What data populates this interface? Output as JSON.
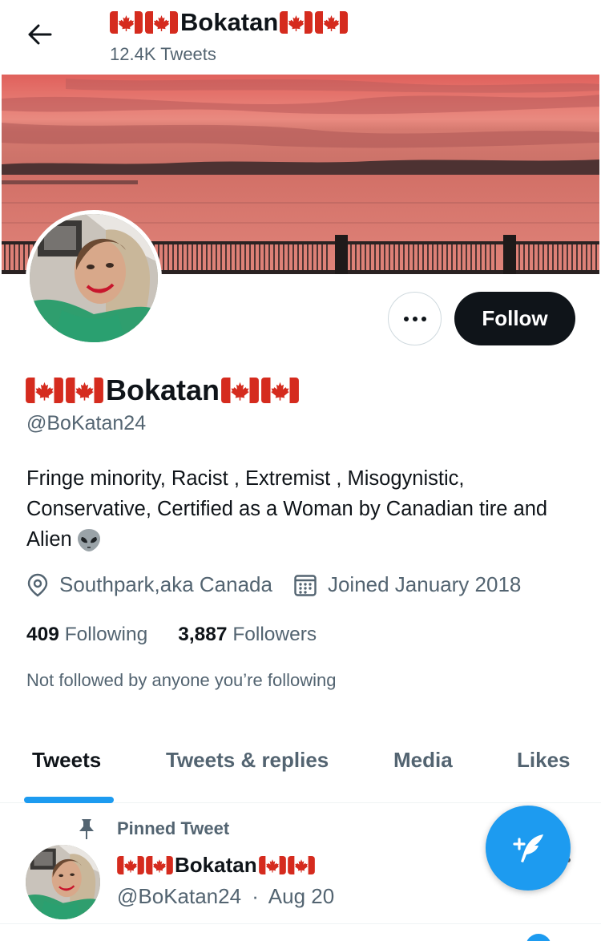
{
  "header": {
    "name": "Bokatan",
    "tweet_count": "12.4K Tweets"
  },
  "profile": {
    "display_name": "Bokatan",
    "handle": "@BoKatan24",
    "bio": "Fringe minority, Racist , Extremist , Misogynistic, Conservative, Certified as a Woman by Canadian tire and Alien",
    "location": "Southpark,aka Canada",
    "joined": "Joined January 2018",
    "following_count": "409",
    "following_label": "Following",
    "followers_count": "3,887",
    "followers_label": "Followers",
    "not_followed": "Not followed by anyone you’re following"
  },
  "actions": {
    "follow_label": "Follow"
  },
  "tabs": [
    {
      "label": "Tweets",
      "active": true
    },
    {
      "label": "Tweets & replies",
      "active": false
    },
    {
      "label": "Media",
      "active": false
    },
    {
      "label": "Likes",
      "active": false
    }
  ],
  "pinned_tweet": {
    "pinned_label": "Pinned Tweet",
    "author_name": "Bokatan",
    "author_handle": "@BoKatan24",
    "separator": "·",
    "date": "Aug 20"
  },
  "colors": {
    "accent": "#1d9bf0",
    "follow_button": "#0f1419",
    "secondary_text": "#536471"
  },
  "icons": {
    "back": "arrow-left-icon",
    "location": "location-pin-icon",
    "calendar": "calendar-icon",
    "pin": "pushpin-icon",
    "compose": "compose-feather-icon",
    "more": "more-horizontal-icon",
    "flag": "canada-flag-icon",
    "alien": "alien-icon"
  }
}
